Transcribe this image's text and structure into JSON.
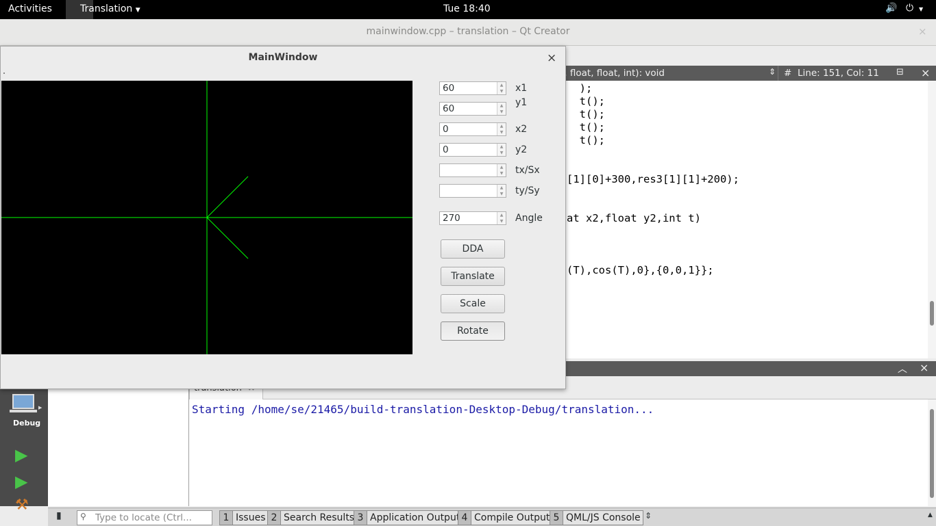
{
  "topbar": {
    "activities": "Activities",
    "app_menu": "Translation",
    "clock": "Tue 18:40"
  },
  "qt_creator": {
    "window_title": "mainwindow.cpp – translation – Qt Creator",
    "editor": {
      "function_combo": "t, float, float, int): void",
      "line_col": "Line: 151, Col: 11",
      "code_lines": [
        "  );",
        "  t();",
        "  t();",
        "  t();",
        "  t();",
        "[1][0]+300,res3[1][1]+200);",
        "at x2,float y2,int t)",
        "(T),cos(T),0},{0,0,1}};"
      ]
    },
    "output": {
      "tab_label": "translation",
      "text": "Starting /home/se/21465/build-translation-Desktop-Debug/translation..."
    },
    "modebar": {
      "debug_label": "Debug"
    },
    "statusbar": {
      "locate_placeholder": "Type to locate (Ctrl...",
      "tabs": [
        {
          "num": "1",
          "label": "Issues"
        },
        {
          "num": "2",
          "label": "Search Results"
        },
        {
          "num": "3",
          "label": "Application Output"
        },
        {
          "num": "4",
          "label": "Compile Output"
        },
        {
          "num": "5",
          "label": "QML/JS Console"
        }
      ]
    }
  },
  "mainwindow": {
    "title": "MainWindow",
    "fields": {
      "x1": {
        "label": "x1",
        "value": "60"
      },
      "y1": {
        "label": "y1",
        "value": "60"
      },
      "x2": {
        "label": "x2",
        "value": "0"
      },
      "y2": {
        "label": "y2",
        "value": "0"
      },
      "tx": {
        "label": "tx/Sx",
        "value": ""
      },
      "ty": {
        "label": "ty/Sy",
        "value": ""
      },
      "angle": {
        "label": "Angle",
        "value": "270"
      }
    },
    "buttons": {
      "dda": "DDA",
      "translate": "Translate",
      "scale": "Scale",
      "rotate": "Rotate"
    },
    "canvas_color": "#00ff00"
  }
}
